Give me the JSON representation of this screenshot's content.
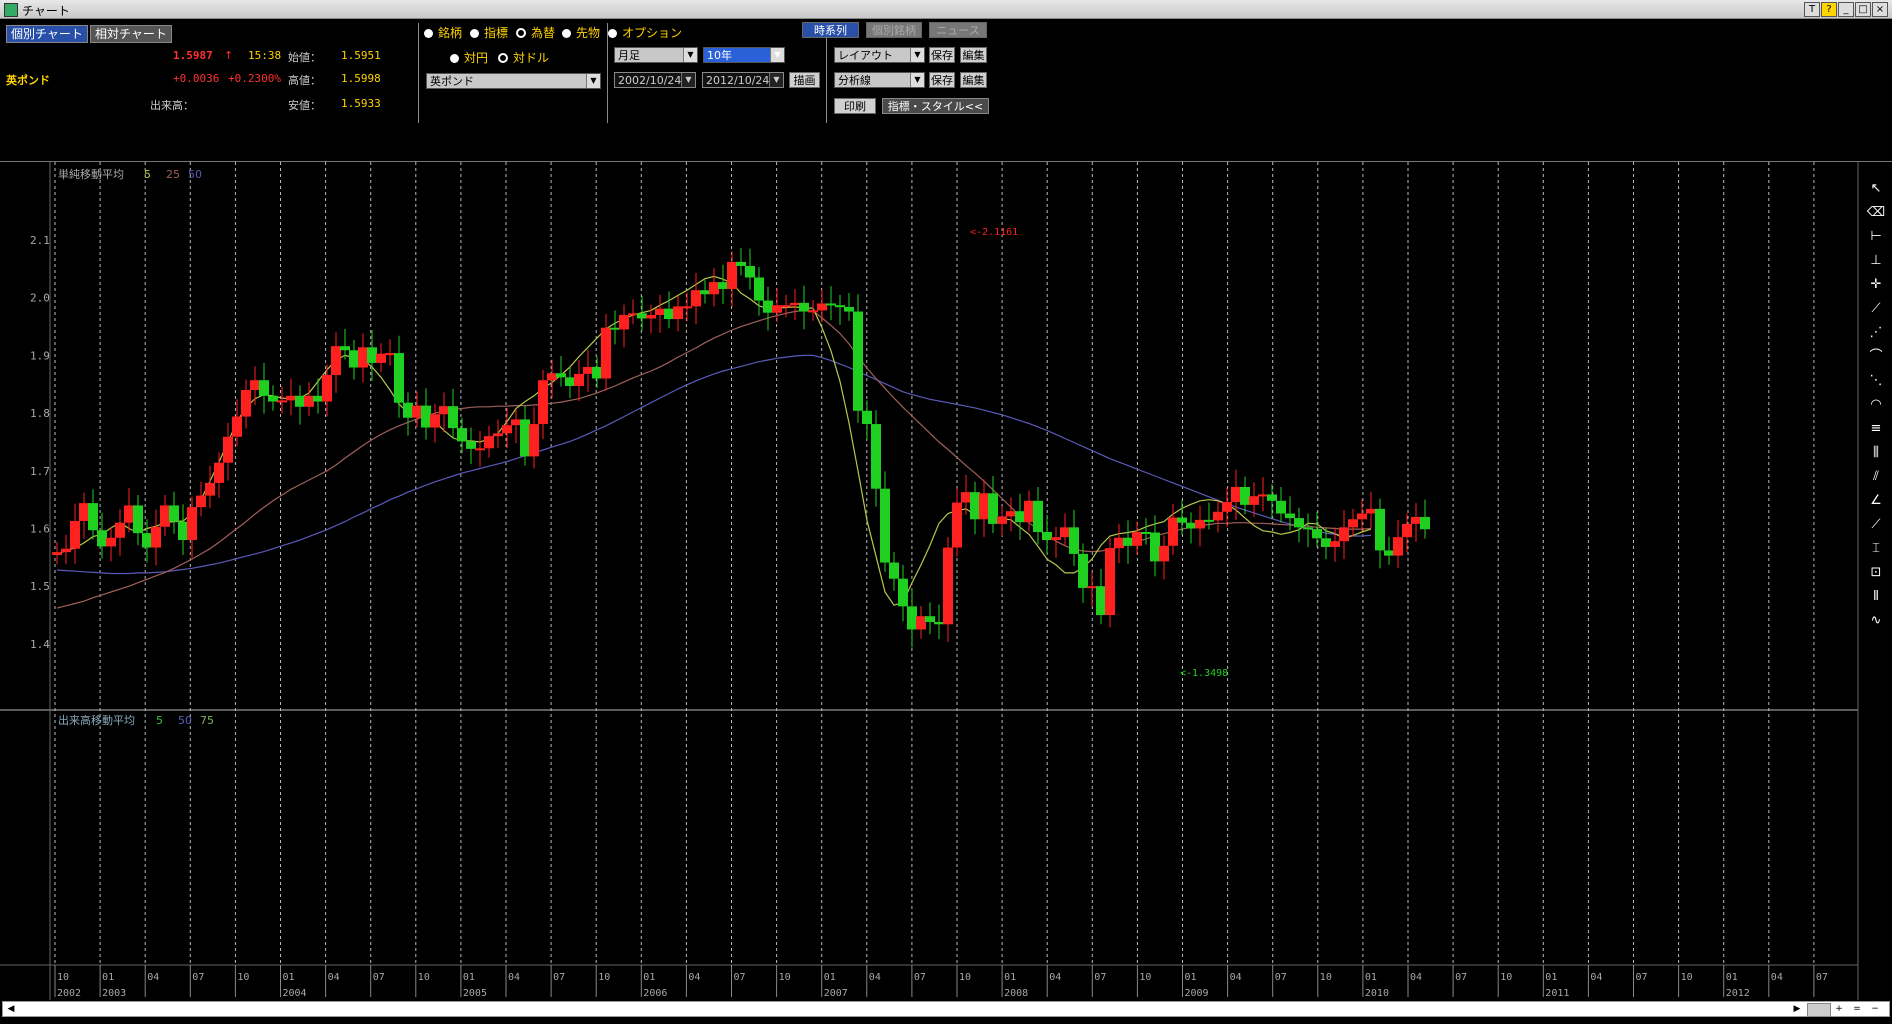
{
  "window": {
    "title": "チャート"
  },
  "tabs": {
    "individual": "個別チャート",
    "relative": "相対チャート"
  },
  "quote": {
    "price": "1.5987",
    "arrow": "↑",
    "time": "15:38",
    "change": "+0.0036",
    "change_pct": "+0.2300%",
    "name": "英ポンド",
    "open_label": "始値：",
    "open": "1.5951",
    "high_label": "高値：",
    "high": "1.5998",
    "low_label": "安値：",
    "low": "1.5933",
    "volume_label": "出来高："
  },
  "radios": {
    "meigara": "銘柄",
    "shihyo": "指標",
    "kawase": "為替",
    "sakimono": "先物",
    "option": "オプション",
    "taien": "対円",
    "taidollar": "対ドル"
  },
  "selectors": {
    "currency": "英ポンド",
    "period_type": "月足",
    "range": "10年",
    "date_from": "2002/10/24",
    "date_to": "2012/10/24"
  },
  "buttons": {
    "draw": "描画",
    "timeseries": "時系列",
    "individual_meigara": "個別銘柄",
    "news": "ニュース",
    "layout": "レイアウト",
    "save": "保存",
    "edit": "編集",
    "analysis": "分析線",
    "print": "印刷",
    "indicator_style": "指標・スタイル<<"
  },
  "colors": {
    "up": "#ff2020",
    "down": "#20d020",
    "ma5": "#b8c84a",
    "ma25": "#a0605a",
    "ma50": "#5a5ab8",
    "grid": "#bbbbbb",
    "tick": "#a8a8a8"
  },
  "chart_data": {
    "type": "candlestick",
    "main_legend": {
      "title": "単純移動平均",
      "periods": [
        "5",
        "25",
        "50"
      ]
    },
    "vol_legend": {
      "title": "出来高移動平均",
      "periods": [
        "5",
        "50",
        "75"
      ]
    },
    "ylim": [
      1.3,
      2.2
    ],
    "yticks": [
      1.4,
      1.5,
      1.6,
      1.7,
      1.8,
      1.9,
      2.0,
      2.1
    ],
    "max_label": "<-2.1161",
    "min_label": "<-1.3498",
    "month_labels": [
      "10",
      "01",
      "04",
      "07",
      "10",
      "01",
      "04",
      "07",
      "10",
      "01",
      "04",
      "07",
      "10",
      "01",
      "04",
      "07",
      "10",
      "01",
      "04",
      "07",
      "10",
      "01",
      "04",
      "07",
      "10",
      "01",
      "04",
      "07",
      "10",
      "01",
      "04",
      "07",
      "10",
      "01",
      "04",
      "07",
      "10",
      "01",
      "04",
      "07"
    ],
    "year_labels": [
      "2002",
      "2003",
      "2004",
      "2005",
      "2006",
      "2007",
      "2008",
      "2009",
      "2010",
      "2011",
      "2012"
    ],
    "closes": [
      1.559,
      1.565,
      1.613,
      1.644,
      1.597,
      1.569,
      1.584,
      1.61,
      1.64,
      1.592,
      1.567,
      1.603,
      1.64,
      1.612,
      1.58,
      1.637,
      1.657,
      1.679,
      1.714,
      1.759,
      1.794,
      1.84,
      1.857,
      1.83,
      1.82,
      1.822,
      1.83,
      1.811,
      1.83,
      1.82,
      1.866,
      1.916,
      1.909,
      1.879,
      1.914,
      1.887,
      1.903,
      1.904,
      1.818,
      1.792,
      1.813,
      1.775,
      1.798,
      1.812,
      1.774,
      1.751,
      1.738,
      1.739,
      1.76,
      1.765,
      1.779,
      1.789,
      1.725,
      1.781,
      1.857,
      1.869,
      1.862,
      1.847,
      1.868,
      1.88,
      1.86,
      1.948,
      1.945,
      1.97,
      1.973,
      1.964,
      1.97,
      1.981,
      1.963,
      1.985,
      1.985,
      2.013,
      2.006,
      2.027,
      2.015,
      2.062,
      2.055,
      2.035,
      1.995,
      1.974,
      1.987,
      1.987,
      1.991,
      1.976,
      1.978,
      1.99,
      1.987,
      1.984,
      1.976,
      1.804,
      1.781,
      1.669,
      1.541,
      1.513,
      1.465,
      1.425,
      1.448,
      1.438,
      1.434,
      1.567,
      1.645,
      1.663,
      1.616,
      1.661,
      1.608,
      1.621,
      1.63,
      1.611,
      1.648,
      1.594,
      1.58,
      1.585,
      1.602,
      1.556,
      1.497,
      1.5,
      1.45,
      1.566,
      1.584,
      1.57,
      1.594,
      1.593,
      1.543,
      1.57,
      1.619,
      1.61,
      1.6,
      1.615,
      1.614,
      1.629,
      1.646,
      1.672,
      1.641,
      1.656,
      1.659,
      1.648,
      1.626,
      1.618,
      1.602,
      1.599,
      1.583,
      1.568,
      1.578,
      1.602,
      1.616,
      1.626,
      1.634,
      1.562,
      1.553,
      1.585,
      1.608,
      1.62,
      1.5987
    ],
    "ma5": [
      1.555,
      1.562,
      1.566,
      1.575,
      1.586,
      1.59,
      1.601,
      1.61,
      1.6,
      1.593,
      1.6,
      1.604,
      1.61,
      1.612,
      1.613,
      1.625,
      1.65,
      1.682,
      1.715,
      1.75,
      1.785,
      1.81,
      1.825,
      1.832,
      1.83,
      1.826,
      1.825,
      1.826,
      1.835,
      1.855,
      1.875,
      1.892,
      1.9,
      1.896,
      1.893,
      1.88,
      1.862,
      1.84,
      1.816,
      1.8,
      1.796,
      1.792,
      1.785,
      1.77,
      1.757,
      1.752,
      1.752,
      1.75,
      1.755,
      1.765,
      1.785,
      1.808,
      1.82,
      1.83,
      1.843,
      1.853,
      1.866,
      1.88,
      1.898,
      1.914,
      1.93,
      1.946,
      1.956,
      1.963,
      1.97,
      1.974,
      1.978,
      1.987,
      1.995,
      2.004,
      2.013,
      2.023,
      2.033,
      2.037,
      2.032,
      2.025,
      2.008,
      1.998,
      1.986,
      1.981,
      1.982,
      1.983,
      1.984,
      1.982,
      1.982,
      1.948,
      1.908,
      1.855,
      1.783,
      1.7,
      1.614,
      1.552,
      1.49,
      1.467,
      1.472,
      1.506,
      1.537,
      1.571,
      1.609,
      1.626,
      1.631,
      1.634,
      1.624,
      1.622,
      1.622,
      1.617,
      1.615,
      1.602,
      1.59,
      1.569,
      1.547,
      1.537,
      1.523,
      1.523,
      1.532,
      1.547,
      1.571,
      1.587,
      1.591,
      1.593,
      1.596,
      1.603,
      1.608,
      1.612,
      1.625,
      1.635,
      1.642,
      1.648,
      1.65,
      1.648,
      1.642,
      1.632,
      1.618,
      1.605,
      1.596,
      1.594,
      1.59,
      1.593,
      1.598,
      1.609,
      1.608,
      1.596,
      1.591,
      1.583,
      1.588,
      1.594,
      1.599
    ],
    "ma25": [
      1.462,
      1.466,
      1.47,
      1.474,
      1.48,
      1.485,
      1.49,
      1.495,
      1.5,
      1.506,
      1.512,
      1.518,
      1.524,
      1.531,
      1.539,
      1.547,
      1.556,
      1.565,
      1.576,
      1.588,
      1.6,
      1.612,
      1.625,
      1.637,
      1.648,
      1.658,
      1.668,
      1.676,
      1.684,
      1.692,
      1.7,
      1.71,
      1.722,
      1.733,
      1.744,
      1.754,
      1.763,
      1.771,
      1.778,
      1.784,
      1.79,
      1.795,
      1.8,
      1.804,
      1.806,
      1.808,
      1.81,
      1.811,
      1.811,
      1.812,
      1.812,
      1.813,
      1.813,
      1.814,
      1.815,
      1.817,
      1.819,
      1.822,
      1.825,
      1.83,
      1.835,
      1.841,
      1.847,
      1.854,
      1.861,
      1.867,
      1.873,
      1.88,
      1.888,
      1.897,
      1.905,
      1.913,
      1.922,
      1.93,
      1.937,
      1.944,
      1.95,
      1.955,
      1.96,
      1.965,
      1.969,
      1.973,
      1.976,
      1.978,
      1.977,
      1.965,
      1.952,
      1.938,
      1.92,
      1.898,
      1.878,
      1.86,
      1.843,
      1.826,
      1.81,
      1.795,
      1.78,
      1.765,
      1.75,
      1.737,
      1.723,
      1.709,
      1.696,
      1.682,
      1.667,
      1.652,
      1.637,
      1.622,
      1.61,
      1.598,
      1.588,
      1.578,
      1.57,
      1.564,
      1.561,
      1.56,
      1.561,
      1.564,
      1.568,
      1.572,
      1.577,
      1.582,
      1.587,
      1.591,
      1.595,
      1.599,
      1.602,
      1.605,
      1.607,
      1.609,
      1.609,
      1.61,
      1.61,
      1.609,
      1.609,
      1.608,
      1.607,
      1.606,
      1.605,
      1.604,
      1.602,
      1.601,
      1.6,
      1.599,
      1.599,
      1.599,
      1.6
    ],
    "ma50": [
      1.528,
      1.527,
      1.526,
      1.525,
      1.524,
      1.523,
      1.522,
      1.522,
      1.522,
      1.523,
      1.523,
      1.524,
      1.525,
      1.527,
      1.529,
      1.531,
      1.534,
      1.537,
      1.54,
      1.544,
      1.548,
      1.552,
      1.556,
      1.56,
      1.565,
      1.57,
      1.575,
      1.58,
      1.586,
      1.592,
      1.598,
      1.605,
      1.612,
      1.62,
      1.627,
      1.635,
      1.642,
      1.65,
      1.656,
      1.663,
      1.669,
      1.675,
      1.681,
      1.686,
      1.691,
      1.696,
      1.7,
      1.704,
      1.708,
      1.712,
      1.716,
      1.721,
      1.726,
      1.731,
      1.736,
      1.741,
      1.746,
      1.751,
      1.757,
      1.764,
      1.771,
      1.778,
      1.786,
      1.794,
      1.802,
      1.81,
      1.818,
      1.826,
      1.834,
      1.842,
      1.849,
      1.856,
      1.862,
      1.868,
      1.873,
      1.877,
      1.881,
      1.885,
      1.889,
      1.892,
      1.895,
      1.897,
      1.899,
      1.9,
      1.9,
      1.896,
      1.891,
      1.885,
      1.879,
      1.872,
      1.865,
      1.858,
      1.851,
      1.844,
      1.837,
      1.832,
      1.828,
      1.824,
      1.821,
      1.818,
      1.815,
      1.812,
      1.809,
      1.805,
      1.801,
      1.797,
      1.792,
      1.787,
      1.782,
      1.776,
      1.77,
      1.763,
      1.756,
      1.749,
      1.742,
      1.735,
      1.728,
      1.721,
      1.715,
      1.709,
      1.703,
      1.697,
      1.691,
      1.685,
      1.679,
      1.673,
      1.667,
      1.661,
      1.655,
      1.649,
      1.643,
      1.637,
      1.632,
      1.627,
      1.622,
      1.617,
      1.612,
      1.608,
      1.604,
      1.6,
      1.596,
      1.592,
      1.59,
      1.588,
      1.587,
      1.587,
      1.588
    ]
  }
}
